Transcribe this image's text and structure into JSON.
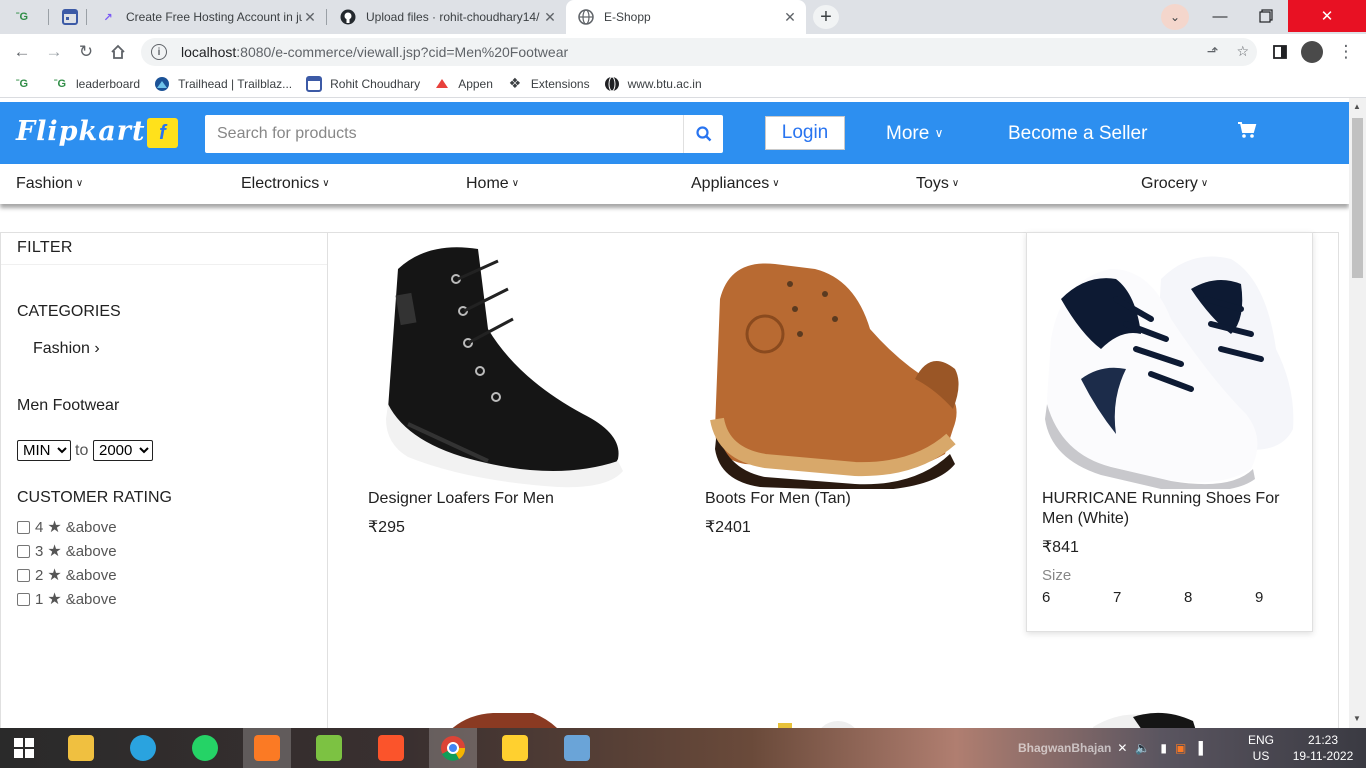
{
  "browser": {
    "tabs": [
      {
        "title": "",
        "icon": "geeks-icon"
      },
      {
        "title": "",
        "icon": "calendar-icon"
      },
      {
        "title": "Create Free Hosting Account in ju",
        "icon": "rocket-icon"
      },
      {
        "title": "Upload files · rohit-choudhary14/",
        "icon": "github-icon"
      },
      {
        "title": "E-Shopp",
        "icon": "globe-icon"
      }
    ],
    "url_host": "localhost",
    "url_path": ":8080/e-commerce/viewall.jsp?cid=Men%20Footwear",
    "bookmarks": [
      "",
      "leaderboard",
      "Trailhead | Trailblaz...",
      "Rohit Choudhary",
      "Appen",
      "Extensions",
      "www.btu.ac.in"
    ]
  },
  "header": {
    "logo": "Flipkart",
    "search_placeholder": "Search for products",
    "login": "Login",
    "more": "More",
    "seller": "Become a Seller",
    "brand_color": "#2d8ff0"
  },
  "categories": [
    "Fashion",
    "Electronics",
    "Home",
    "Appliances",
    "Toys",
    "Grocery"
  ],
  "filter": {
    "title": "FILTER",
    "categories_heading": "CATEGORIES",
    "category_link": "Fashion",
    "subcategory": "Men Footwear",
    "price_min": "MIN",
    "price_to": "to",
    "price_max": "2000",
    "rating_heading": "CUSTOMER RATING",
    "ratings": [
      {
        "value": "4",
        "suffix": "&above"
      },
      {
        "value": "3",
        "suffix": "&above"
      },
      {
        "value": "2",
        "suffix": "&above"
      },
      {
        "value": "1",
        "suffix": "&above"
      }
    ]
  },
  "products": [
    {
      "name": "Designer Loafers For Men",
      "price": "₹295"
    },
    {
      "name": "Boots For Men (Tan)",
      "price": "₹2401"
    },
    {
      "name": "HURRICANE Running Shoes For Men (White)",
      "price": "₹841",
      "size_label": "Size",
      "sizes": [
        "6",
        "7",
        "8",
        "9"
      ]
    }
  ],
  "taskbar": {
    "tray_text": "BhagwanBhajan",
    "lang": "ENG",
    "region": "US",
    "time": "21:23",
    "date": "19-11-2022"
  }
}
